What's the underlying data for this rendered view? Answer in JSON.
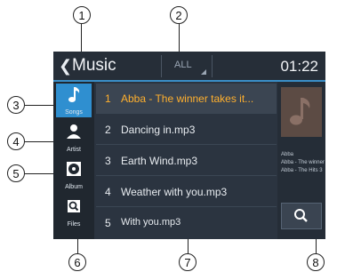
{
  "header": {
    "title": "Music",
    "filter_label": "ALL",
    "clock": "01:22"
  },
  "rail": {
    "items": [
      {
        "label": "Songs",
        "icon": "music-note-icon",
        "active": true
      },
      {
        "label": "Artist",
        "icon": "person-icon",
        "active": false
      },
      {
        "label": "Album",
        "icon": "disc-icon",
        "active": false
      },
      {
        "label": "Files",
        "icon": "folder-search-icon",
        "active": false
      }
    ]
  },
  "songs": [
    {
      "num": "1",
      "title": "Abba - The winner takes it...",
      "highlighted": true
    },
    {
      "num": "2",
      "title": "Dancing in.mp3",
      "highlighted": false
    },
    {
      "num": "3",
      "title": "Earth Wind.mp3",
      "highlighted": false
    },
    {
      "num": "4",
      "title": "Weather with you.mp3",
      "highlighted": false
    },
    {
      "num": "5",
      "title": "With you.mp3",
      "highlighted": false
    }
  ],
  "now_playing": {
    "artist": "Abba",
    "track": "Abba - The winner",
    "album": "Abba - The Hits 3"
  },
  "callouts": [
    "1",
    "2",
    "3",
    "4",
    "5",
    "6",
    "7",
    "8"
  ],
  "colors": {
    "screen_bg": "#2b3440",
    "accent_blue": "#2f8fd0",
    "highlight_text": "#ffb02e"
  }
}
